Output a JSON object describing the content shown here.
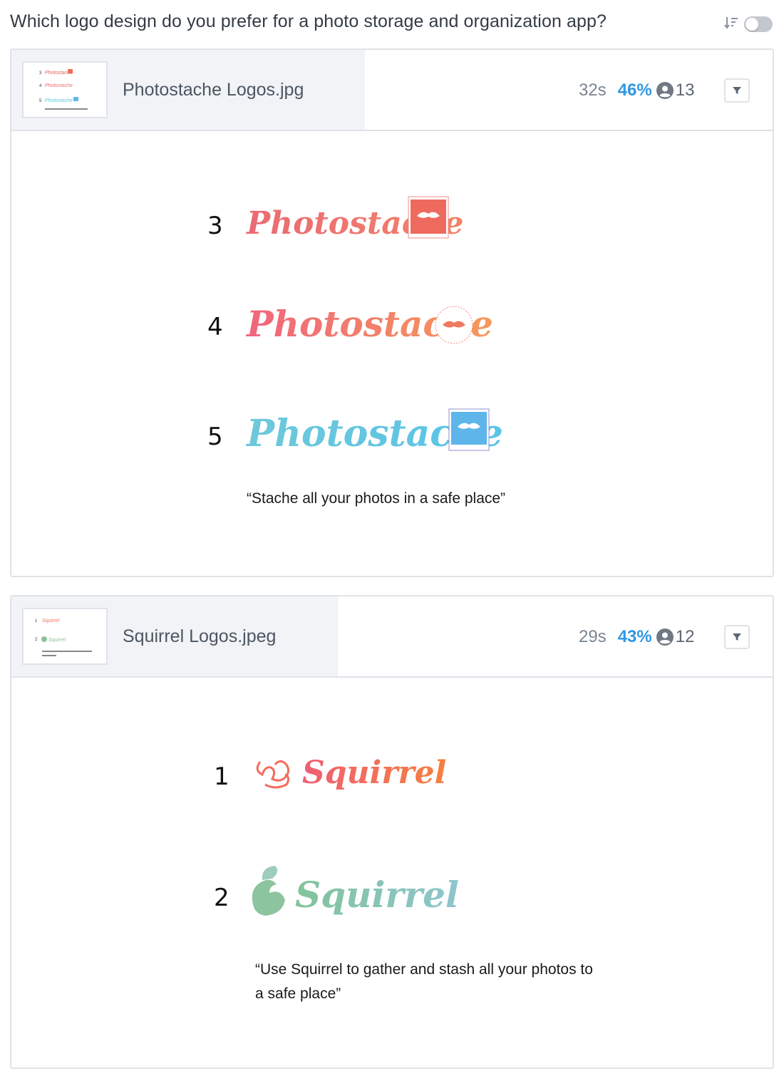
{
  "question": {
    "title": "Which logo design do you prefer for a photo storage and organization app?"
  },
  "colors": {
    "accent": "#2f97e3",
    "border": "#dfe3e8",
    "panel": "#f2f3f6"
  },
  "cards": [
    {
      "file_name": "Photostache Logos.jpg",
      "time": "32s",
      "percent": "46%",
      "count": "13",
      "slide": {
        "rows": [
          {
            "number": "3",
            "wordmark": "Photostache"
          },
          {
            "number": "4",
            "wordmark": "Photostache"
          },
          {
            "number": "5",
            "wordmark": "Photostache"
          }
        ],
        "tagline": "“Stache all your photos in a safe place”"
      }
    },
    {
      "file_name": "Squirrel Logos.jpeg",
      "time": "29s",
      "percent": "43%",
      "count": "12",
      "slide": {
        "rows": [
          {
            "number": "1",
            "wordmark": "Squirrel"
          },
          {
            "number": "2",
            "wordmark": "Squirrel"
          }
        ],
        "tagline_line1": "“Use Squirrel to gather and stash all your photos to",
        "tagline_line2": "a safe place”"
      }
    }
  ]
}
